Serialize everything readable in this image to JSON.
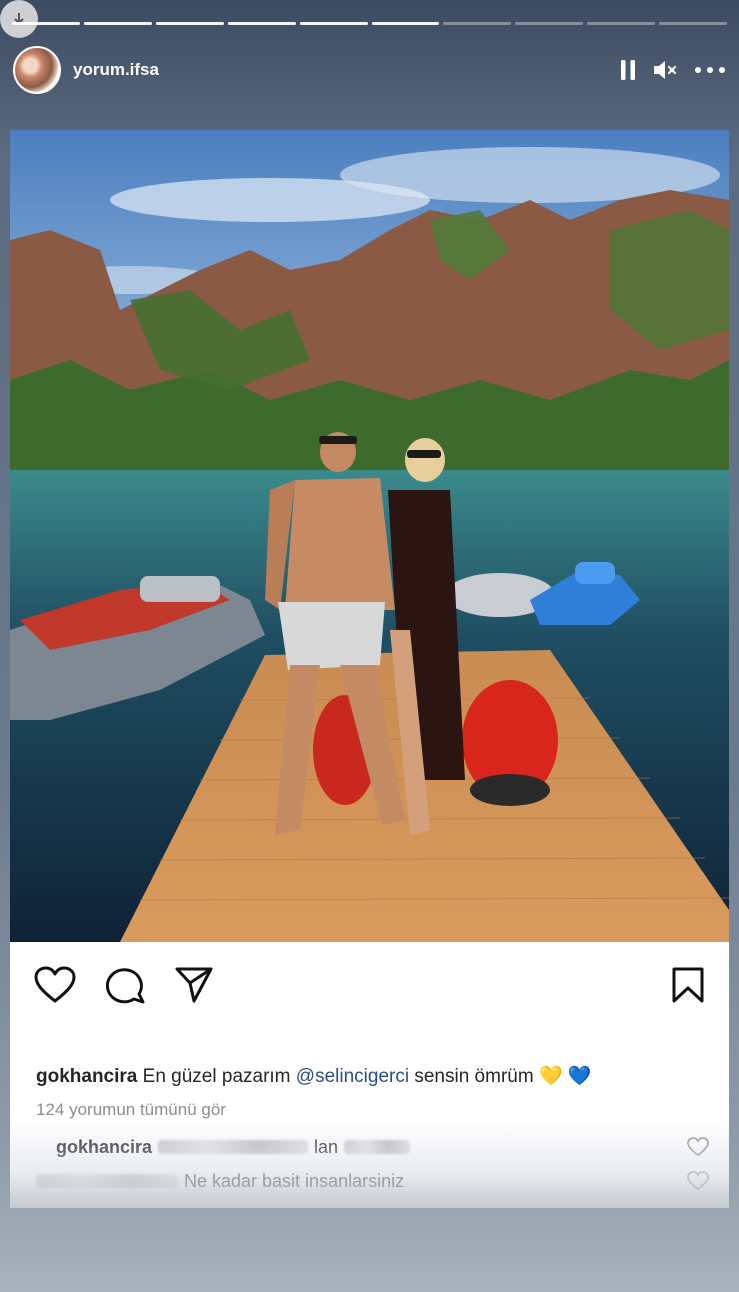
{
  "story": {
    "segments_total": 10,
    "segments_done": 6,
    "username": "yorum.ifsa"
  },
  "post": {
    "caption": {
      "user": "gokhancira",
      "text": " En güzel pazarım ",
      "mention": "@selincigerci",
      "text2": " sensin ömrüm ",
      "emoji": "💛 💙"
    },
    "view_all_comments": "124 yorumun tümünü gör",
    "comments": [
      {
        "user": "gokhancira",
        "text": "lan"
      },
      {
        "user": "",
        "text": "Ne kadar basit insanlarsiniz"
      }
    ]
  },
  "icons": [
    "back-icon",
    "pause-icon",
    "mute-icon",
    "more-icon",
    "like-icon",
    "comment-icon",
    "share-icon",
    "bookmark-icon"
  ]
}
